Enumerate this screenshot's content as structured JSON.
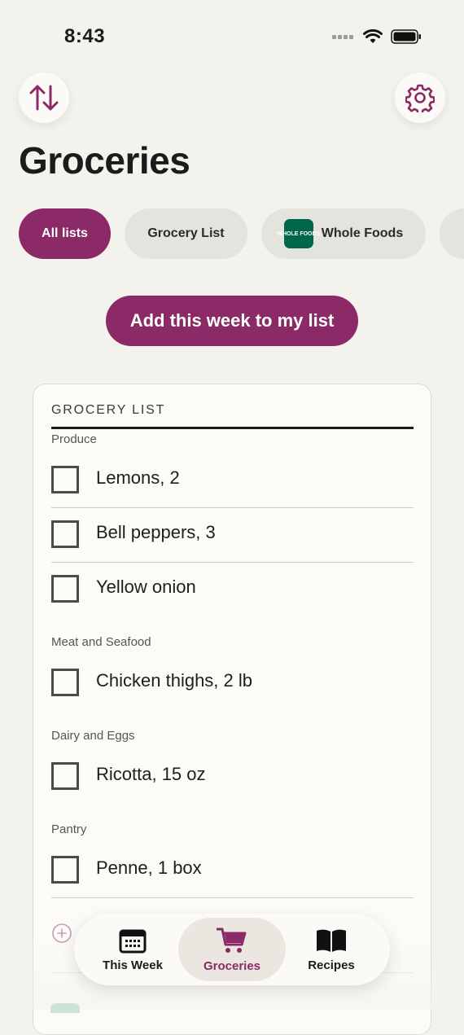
{
  "status_bar": {
    "time": "8:43"
  },
  "header": {
    "title": "Groceries"
  },
  "filters": [
    {
      "label": "All lists",
      "active": true
    },
    {
      "label": "Grocery List",
      "active": false
    },
    {
      "label": "Whole Foods",
      "active": false,
      "logo_text": "WHOLE FOODS"
    }
  ],
  "actions": {
    "add_week_label": "Add this week to my list"
  },
  "list": {
    "title": "GROCERY LIST",
    "sections": [
      {
        "name": "Produce",
        "items": [
          "Lemons, 2",
          "Bell peppers, 3",
          "Yellow onion"
        ]
      },
      {
        "name": "Meat and Seafood",
        "items": [
          "Chicken thighs, 2 lb"
        ]
      },
      {
        "name": "Dairy and Eggs",
        "items": [
          "Ricotta, 15 oz"
        ]
      },
      {
        "name": "Pantry",
        "items": [
          "Penne, 1 box"
        ]
      }
    ]
  },
  "tabbar": {
    "tabs": [
      {
        "label": "This Week",
        "icon": "calendar-icon",
        "active": false
      },
      {
        "label": "Groceries",
        "icon": "cart-icon",
        "active": true
      },
      {
        "label": "Recipes",
        "icon": "book-icon",
        "active": false
      }
    ]
  },
  "colors": {
    "accent": "#8b2a66",
    "background": "#f4f2ed",
    "card": "#fcfbf7",
    "whole_foods": "#00674b"
  }
}
